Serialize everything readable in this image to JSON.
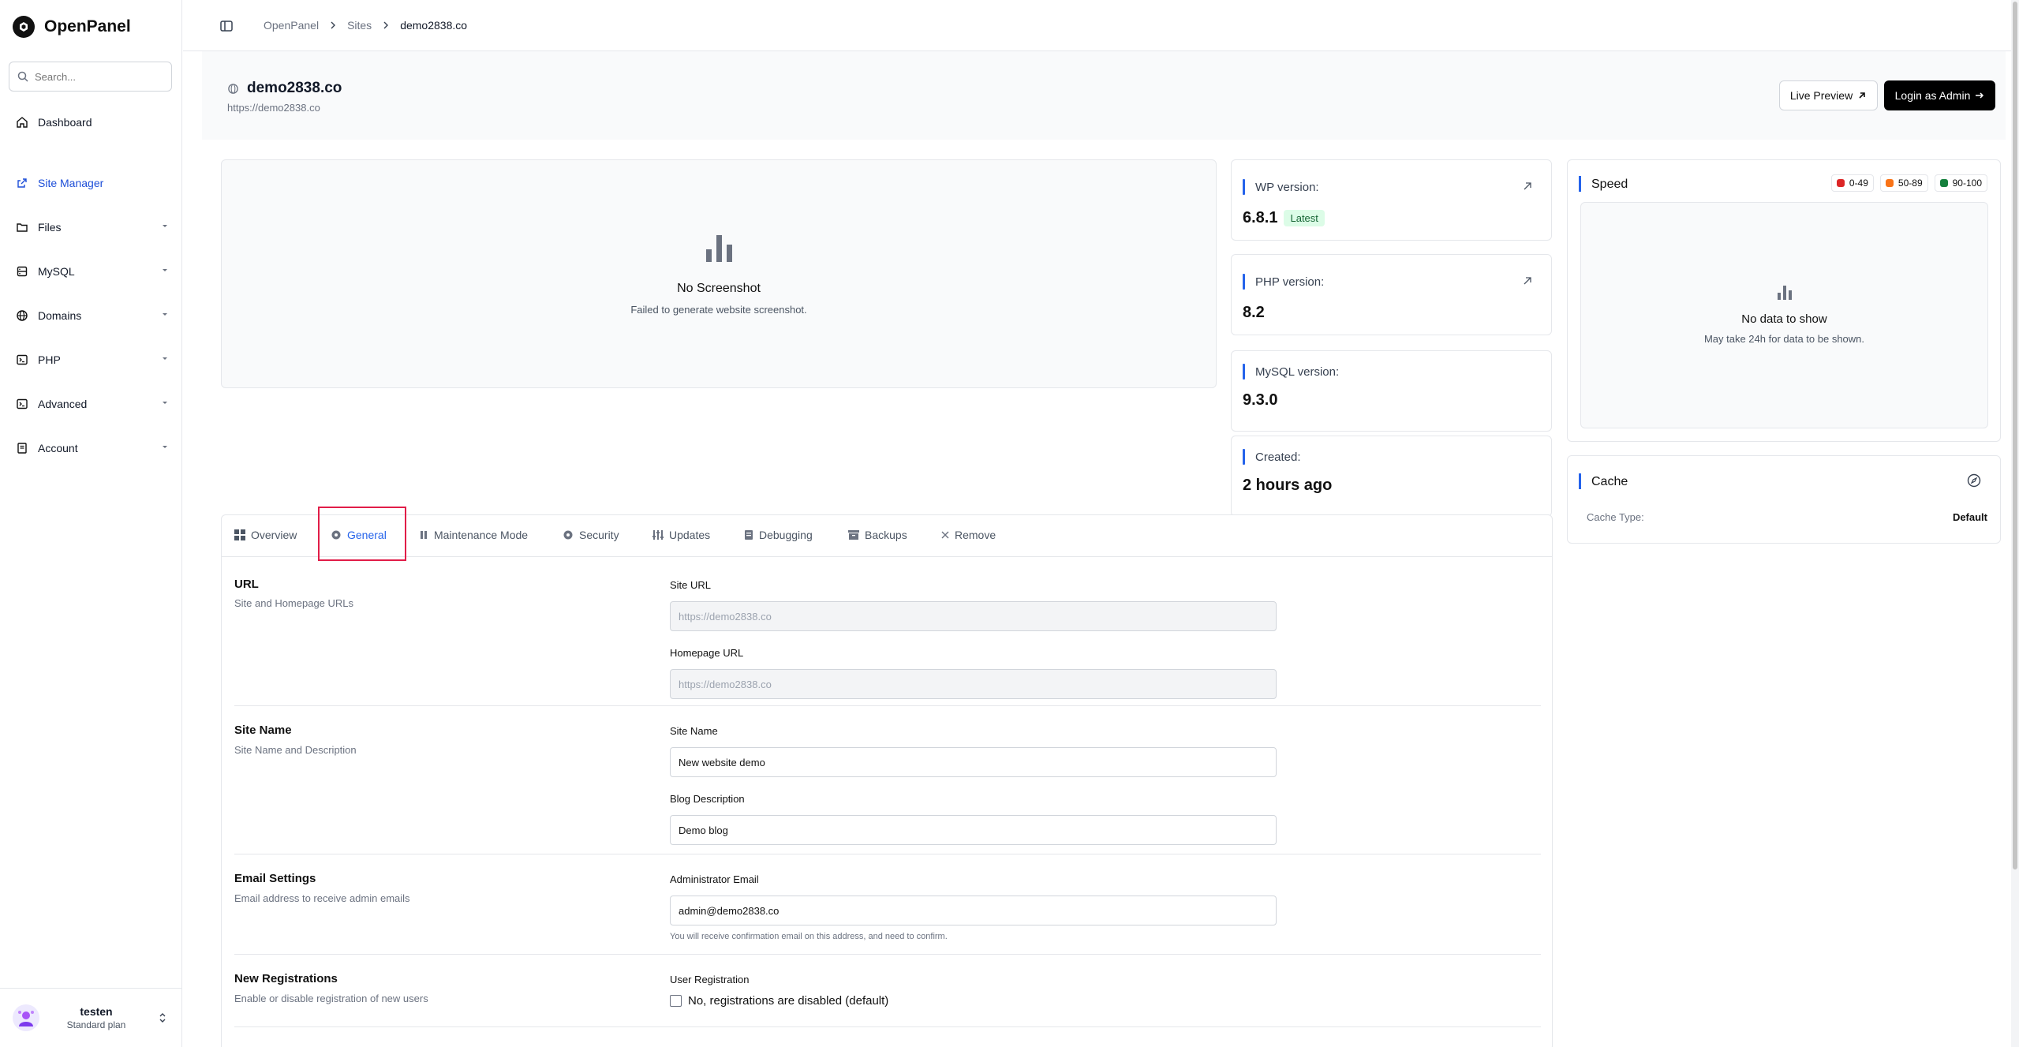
{
  "app": {
    "name": "OpenPanel"
  },
  "search": {
    "placeholder": "Search..."
  },
  "sidebar": {
    "items": [
      {
        "label": "Dashboard",
        "icon": "home-icon"
      },
      {
        "label": "Site Manager",
        "icon": "external-link-icon",
        "active": true
      },
      {
        "label": "Files",
        "icon": "folder-icon"
      },
      {
        "label": "MySQL",
        "icon": "database-icon"
      },
      {
        "label": "Domains",
        "icon": "globe-icon"
      },
      {
        "label": "PHP",
        "icon": "terminal-icon"
      },
      {
        "label": "Advanced",
        "icon": "terminal-icon"
      },
      {
        "label": "Account",
        "icon": "book-icon"
      }
    ],
    "user": {
      "name": "testen",
      "plan": "Standard plan"
    }
  },
  "breadcrumb": [
    "OpenPanel",
    "Sites",
    "demo2838.co"
  ],
  "header": {
    "site_name": "demo2838.co",
    "site_url": "https://demo2838.co",
    "live_preview": "Live Preview",
    "login_admin": "Login as Admin"
  },
  "screenshot": {
    "title": "No Screenshot",
    "subtitle": "Failed to generate website screenshot."
  },
  "info": {
    "wp_label": "WP version:",
    "wp_value": "6.8.1",
    "wp_badge": "Latest",
    "php_label": "PHP version:",
    "php_value": "8.2",
    "mysql_label": "MySQL version:",
    "mysql_value": "9.3.0",
    "created_label": "Created:",
    "created_value": "2 hours ago"
  },
  "speed": {
    "title": "Speed",
    "legend": [
      {
        "label": "0-49",
        "color": "#dc2626"
      },
      {
        "label": "50-89",
        "color": "#f97316"
      },
      {
        "label": "90-100",
        "color": "#15803d"
      }
    ],
    "empty_title": "No data to show",
    "empty_subtitle": "May take 24h for data to be shown."
  },
  "cache": {
    "title": "Cache",
    "type_label": "Cache Type:",
    "type_value": "Default"
  },
  "tabs": [
    {
      "label": "Overview",
      "icon": "grid-icon"
    },
    {
      "label": "General",
      "icon": "gear-icon",
      "active": true
    },
    {
      "label": "Maintenance Mode",
      "icon": "pause-icon"
    },
    {
      "label": "Security",
      "icon": "gear-icon"
    },
    {
      "label": "Updates",
      "icon": "sliders-icon"
    },
    {
      "label": "Debugging",
      "icon": "clipboard-icon"
    },
    {
      "label": "Backups",
      "icon": "archive-icon"
    },
    {
      "label": "Remove",
      "icon": "close-icon"
    }
  ],
  "general": {
    "url": {
      "title": "URL",
      "desc": "Site and Homepage URLs",
      "site_url_label": "Site URL",
      "site_url_value": "https://demo2838.co",
      "home_url_label": "Homepage URL",
      "home_url_value": "https://demo2838.co"
    },
    "site_name": {
      "title": "Site Name",
      "desc": "Site Name and Description",
      "name_label": "Site Name",
      "name_value": "New website demo",
      "blog_label": "Blog Description",
      "blog_value": "Demo blog"
    },
    "email": {
      "title": "Email Settings",
      "desc": "Email address to receive admin emails",
      "label": "Administrator Email",
      "value": "admin@demo2838.co",
      "hint": "You will receive confirmation email on this address, and need to confirm."
    },
    "registrations": {
      "title": "New Registrations",
      "desc": "Enable or disable registration of new users",
      "label": "User Registration",
      "checkbox_label": "No, registrations are disabled (default)"
    }
  }
}
